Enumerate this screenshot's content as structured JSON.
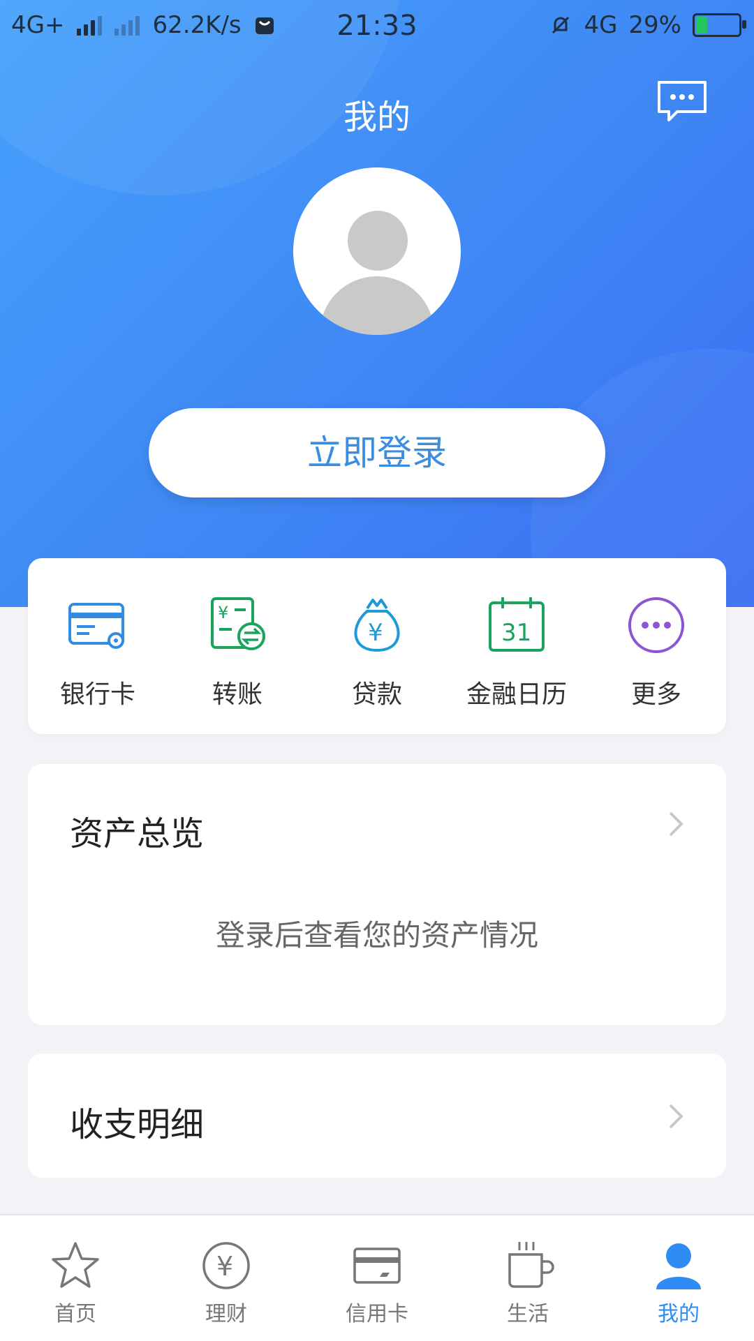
{
  "status_bar": {
    "network": "4G+",
    "speed": "62.2K/s",
    "time": "21:33",
    "network2": "4G",
    "battery": "29%",
    "battery_level": 0.29
  },
  "header": {
    "title": "我的",
    "message_icon": "chat-bubble-icon",
    "avatar_icon": "default-avatar-icon",
    "login_button": "立即登录"
  },
  "quick_actions": [
    {
      "label": "银行卡",
      "icon": "bank-card-icon",
      "color": "#2f8ce0"
    },
    {
      "label": "转账",
      "icon": "transfer-icon",
      "color": "#1aa35c"
    },
    {
      "label": "贷款",
      "icon": "loan-bag-icon",
      "color": "#1f9ad8"
    },
    {
      "label": "金融日历",
      "icon": "calendar-icon",
      "color": "#1aa35c",
      "calendar_day": "31"
    },
    {
      "label": "更多",
      "icon": "more-icon",
      "color": "#8a56d6"
    }
  ],
  "asset_overview": {
    "title": "资产总览",
    "note": "登录后查看您的资产情况"
  },
  "income_expense": {
    "title": "收支明细"
  },
  "tabbar": {
    "active_color": "#2f8cf4",
    "items": [
      {
        "label": "首页",
        "icon": "star-icon"
      },
      {
        "label": "理财",
        "icon": "yen-coin-icon"
      },
      {
        "label": "信用卡",
        "icon": "credit-card-icon"
      },
      {
        "label": "生活",
        "icon": "coffee-cup-icon"
      },
      {
        "label": "我的",
        "icon": "person-icon"
      }
    ]
  }
}
